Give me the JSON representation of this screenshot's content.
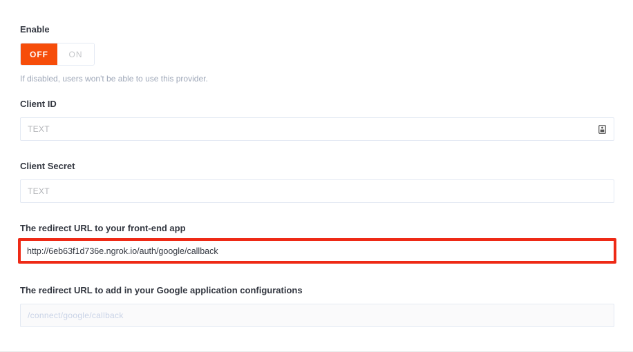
{
  "enable": {
    "label": "Enable",
    "off_label": "OFF",
    "on_label": "ON",
    "state": "off",
    "hint": "If disabled, users won't be able to use this provider."
  },
  "client_id": {
    "label": "Client ID",
    "placeholder": "TEXT",
    "icon": "key-icon"
  },
  "client_secret": {
    "label": "Client Secret",
    "placeholder": "TEXT"
  },
  "redirect_frontend": {
    "label": "The redirect URL to your front-end app",
    "value": "http://6eb63f1d736e.ngrok.io/auth/google/callback"
  },
  "redirect_google": {
    "label": "The redirect URL to add in your Google application configurations",
    "placeholder": "/connect/google/callback"
  },
  "colors": {
    "accent": "#f64d0a",
    "highlight_border": "#ee2a16"
  }
}
